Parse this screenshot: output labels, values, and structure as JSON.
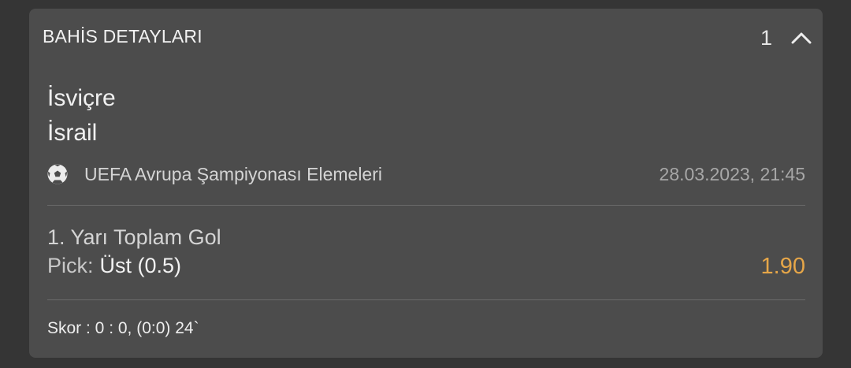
{
  "header": {
    "title": "BAHİS DETAYLARI",
    "count": "1",
    "collapse_icon": "chevron-up-icon"
  },
  "event": {
    "home_team": "İsviçre",
    "away_team": "İsrail",
    "sport_icon": "soccer-ball-icon",
    "league": "UEFA Avrupa Şampiyonası Elemeleri",
    "datetime": "28.03.2023, 21:45"
  },
  "bet": {
    "market": "1. Yarı Toplam Gol",
    "pick_label": "Pick:",
    "pick_value": "Üst (0.5)",
    "odds": "1.90"
  },
  "score": {
    "text": "Skor : 0 : 0, (0:0) 24`"
  },
  "colors": {
    "background": "#353535",
    "card": "#4c4c4c",
    "odds": "#e6a648",
    "divider": "#6a6a6a"
  }
}
